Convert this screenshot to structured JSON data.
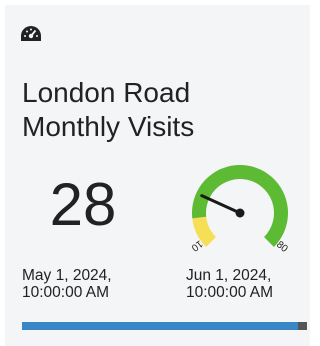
{
  "widget": {
    "icon": "dashboard-gauge-icon",
    "title_line1": "London Road",
    "title_line2": "Monthly Visits",
    "value": "28",
    "start_date": "May 1, 2024,\n10:00:00 AM",
    "end_date": "Jun 1, 2024,\n10:00:00 AM"
  },
  "gauge": {
    "min_label": "10",
    "max_label": "80",
    "value": 28,
    "min": 10,
    "max": 80,
    "low_threshold": 20,
    "colors": {
      "low": "#f7de57",
      "normal": "#5dbb33",
      "needle": "#1a1a1a"
    }
  },
  "progress": {
    "fraction": 0.97,
    "colors": {
      "fill": "#3a87c8",
      "track": "#555555"
    }
  }
}
